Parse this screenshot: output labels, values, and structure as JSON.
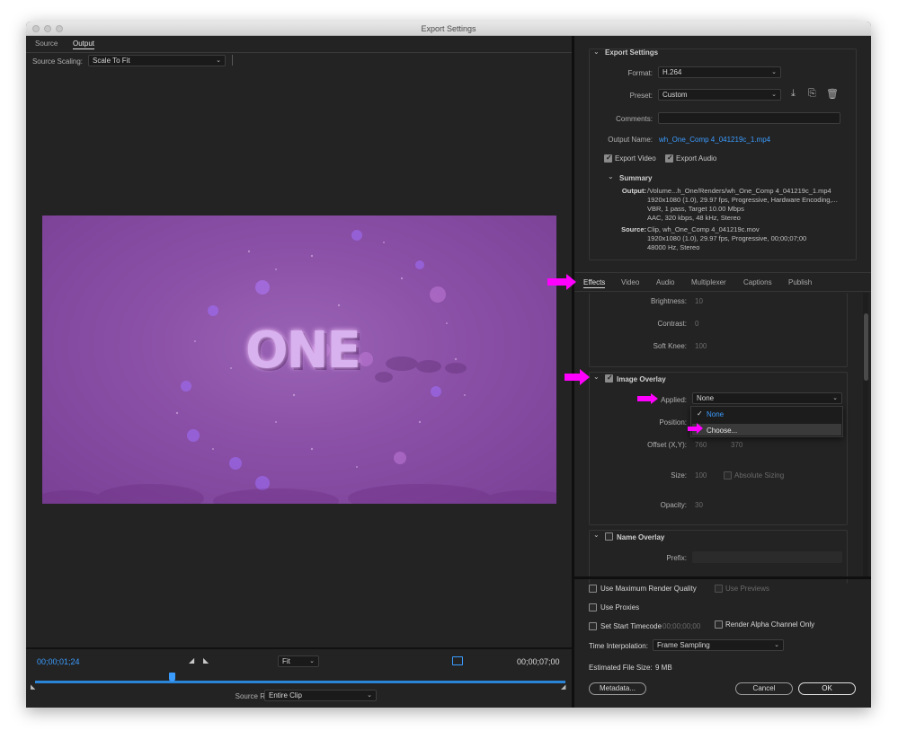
{
  "window": {
    "title": "Export Settings"
  },
  "left": {
    "tabs": [
      "Source",
      "Output"
    ],
    "source_scaling": {
      "label": "Source Scaling:",
      "value": "Scale To Fit"
    },
    "preview": {
      "title_text": "ONE"
    },
    "timecode_current": "00;00;01;24",
    "timecode_end": "00;00;07;00",
    "zoom": "Fit",
    "source_range": {
      "label": "Source Range:",
      "value": "Entire Clip"
    },
    "playhead_fraction": 0.258
  },
  "export": {
    "header": "Export Settings",
    "format_label": "Format:",
    "format_value": "H.264",
    "preset_label": "Preset:",
    "preset_value": "Custom",
    "comments_label": "Comments:",
    "output_name_label": "Output Name:",
    "output_name_value": "wh_One_Comp 4_041219c_1.mp4",
    "export_video": "Export Video",
    "export_audio": "Export Audio",
    "summary_header": "Summary",
    "summary_output_label": "Output:",
    "summary_output_lines": [
      "/Volume...h_One/Renders/wh_One_Comp 4_041219c_1.mp4",
      "1920x1080 (1.0), 29.97 fps, Progressive, Hardware Encoding,...",
      "VBR, 1 pass, Target 10.00 Mbps",
      "AAC, 320 kbps, 48 kHz, Stereo"
    ],
    "summary_source_label": "Source:",
    "summary_source_lines": [
      "Clip, wh_One_Comp 4_041219c.mov",
      "1920x1080 (1.0), 29.97 fps, Progressive, 00;00;07;00",
      "48000 Hz, Stereo"
    ]
  },
  "tabs": [
    "Effects",
    "Video",
    "Audio",
    "Multiplexer",
    "Captions",
    "Publish"
  ],
  "effects": {
    "brightness_label": "Brightness:",
    "brightness_value": "10",
    "contrast_label": "Contrast:",
    "contrast_value": "0",
    "soft_knee_label": "Soft Knee:",
    "soft_knee_value": "100",
    "image_overlay_header": "Image Overlay",
    "applied_label": "Applied:",
    "applied_value": "None",
    "menu_none": "None",
    "menu_choose": "Choose...",
    "position_label": "Position:",
    "offset_label": "Offset (X,Y):",
    "offset_x": "760",
    "offset_y": "370",
    "size_label": "Size:",
    "size_value": "100",
    "absolute_sizing": "Absolute Sizing",
    "opacity_label": "Opacity:",
    "opacity_value": "30",
    "name_overlay_header": "Name Overlay",
    "prefix_label": "Prefix:"
  },
  "bottom": {
    "max_render_quality": "Use Maximum Render Quality",
    "use_previews": "Use Previews",
    "use_proxies": "Use Proxies",
    "set_start_timecode": "Set Start Timecode",
    "start_timecode_value": "00;00;00;00",
    "render_alpha": "Render Alpha Channel Only",
    "time_interp_label": "Time Interpolation:",
    "time_interp_value": "Frame Sampling",
    "file_size_label": "Estimated File Size:",
    "file_size_value": "9 MB",
    "metadata_button": "Metadata...",
    "cancel_button": "Cancel",
    "ok_button": "OK"
  },
  "colors": {
    "accent": "#3b9cff",
    "annotation": "#ff00ff",
    "preview": "#8b4fa8"
  }
}
